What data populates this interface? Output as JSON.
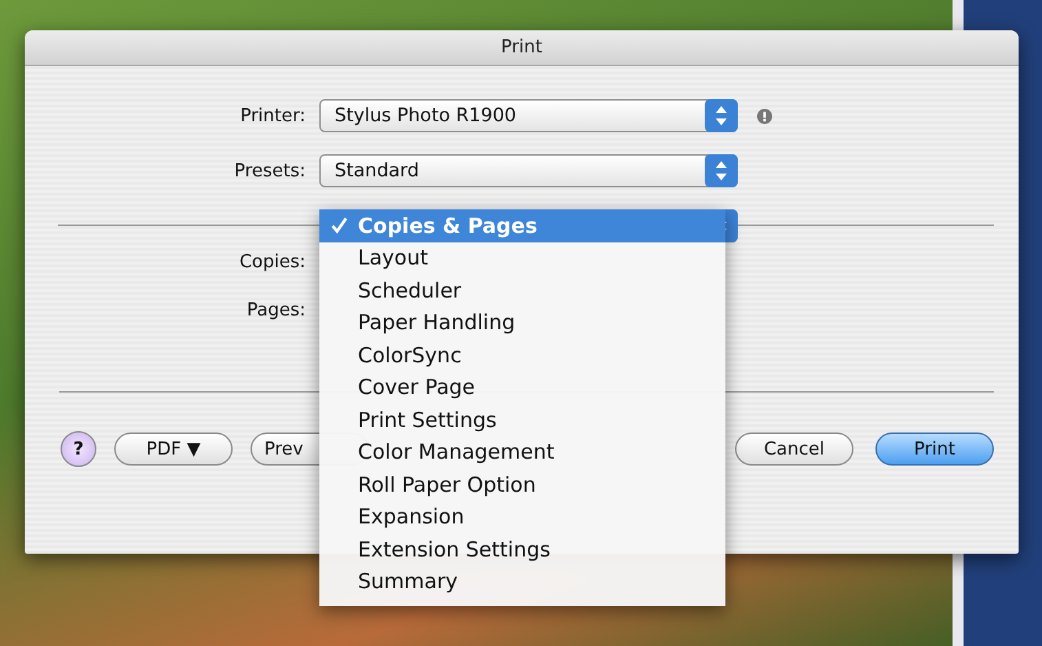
{
  "window": {
    "title": "Print"
  },
  "printer": {
    "label": "Printer:",
    "value": "Stylus Photo R1900"
  },
  "presets": {
    "label": "Presets:",
    "value": "Standard"
  },
  "panel_menu": {
    "items": [
      {
        "label": "Copies & Pages",
        "selected": true
      },
      {
        "label": "Layout",
        "selected": false
      },
      {
        "label": "Scheduler",
        "selected": false
      },
      {
        "label": "Paper Handling",
        "selected": false
      },
      {
        "label": "ColorSync",
        "selected": false
      },
      {
        "label": "Cover Page",
        "selected": false
      },
      {
        "label": "Print Settings",
        "selected": false
      },
      {
        "label": "Color Management",
        "selected": false
      },
      {
        "label": "Roll Paper Option",
        "selected": false
      },
      {
        "label": "Expansion",
        "selected": false
      },
      {
        "label": "Extension Settings",
        "selected": false
      },
      {
        "label": "Summary",
        "selected": false
      }
    ]
  },
  "fields": [
    {
      "label": "Copies:"
    },
    {
      "label": "Pages:"
    }
  ],
  "buttons": [
    {
      "label": "?",
      "kind": "help"
    },
    {
      "label": "PDF ▼",
      "kind": "normal"
    },
    {
      "label": "Prev",
      "kind": "normal"
    },
    {
      "label": "Cancel",
      "kind": "normal"
    },
    {
      "label": "Print",
      "kind": "default"
    }
  ]
}
